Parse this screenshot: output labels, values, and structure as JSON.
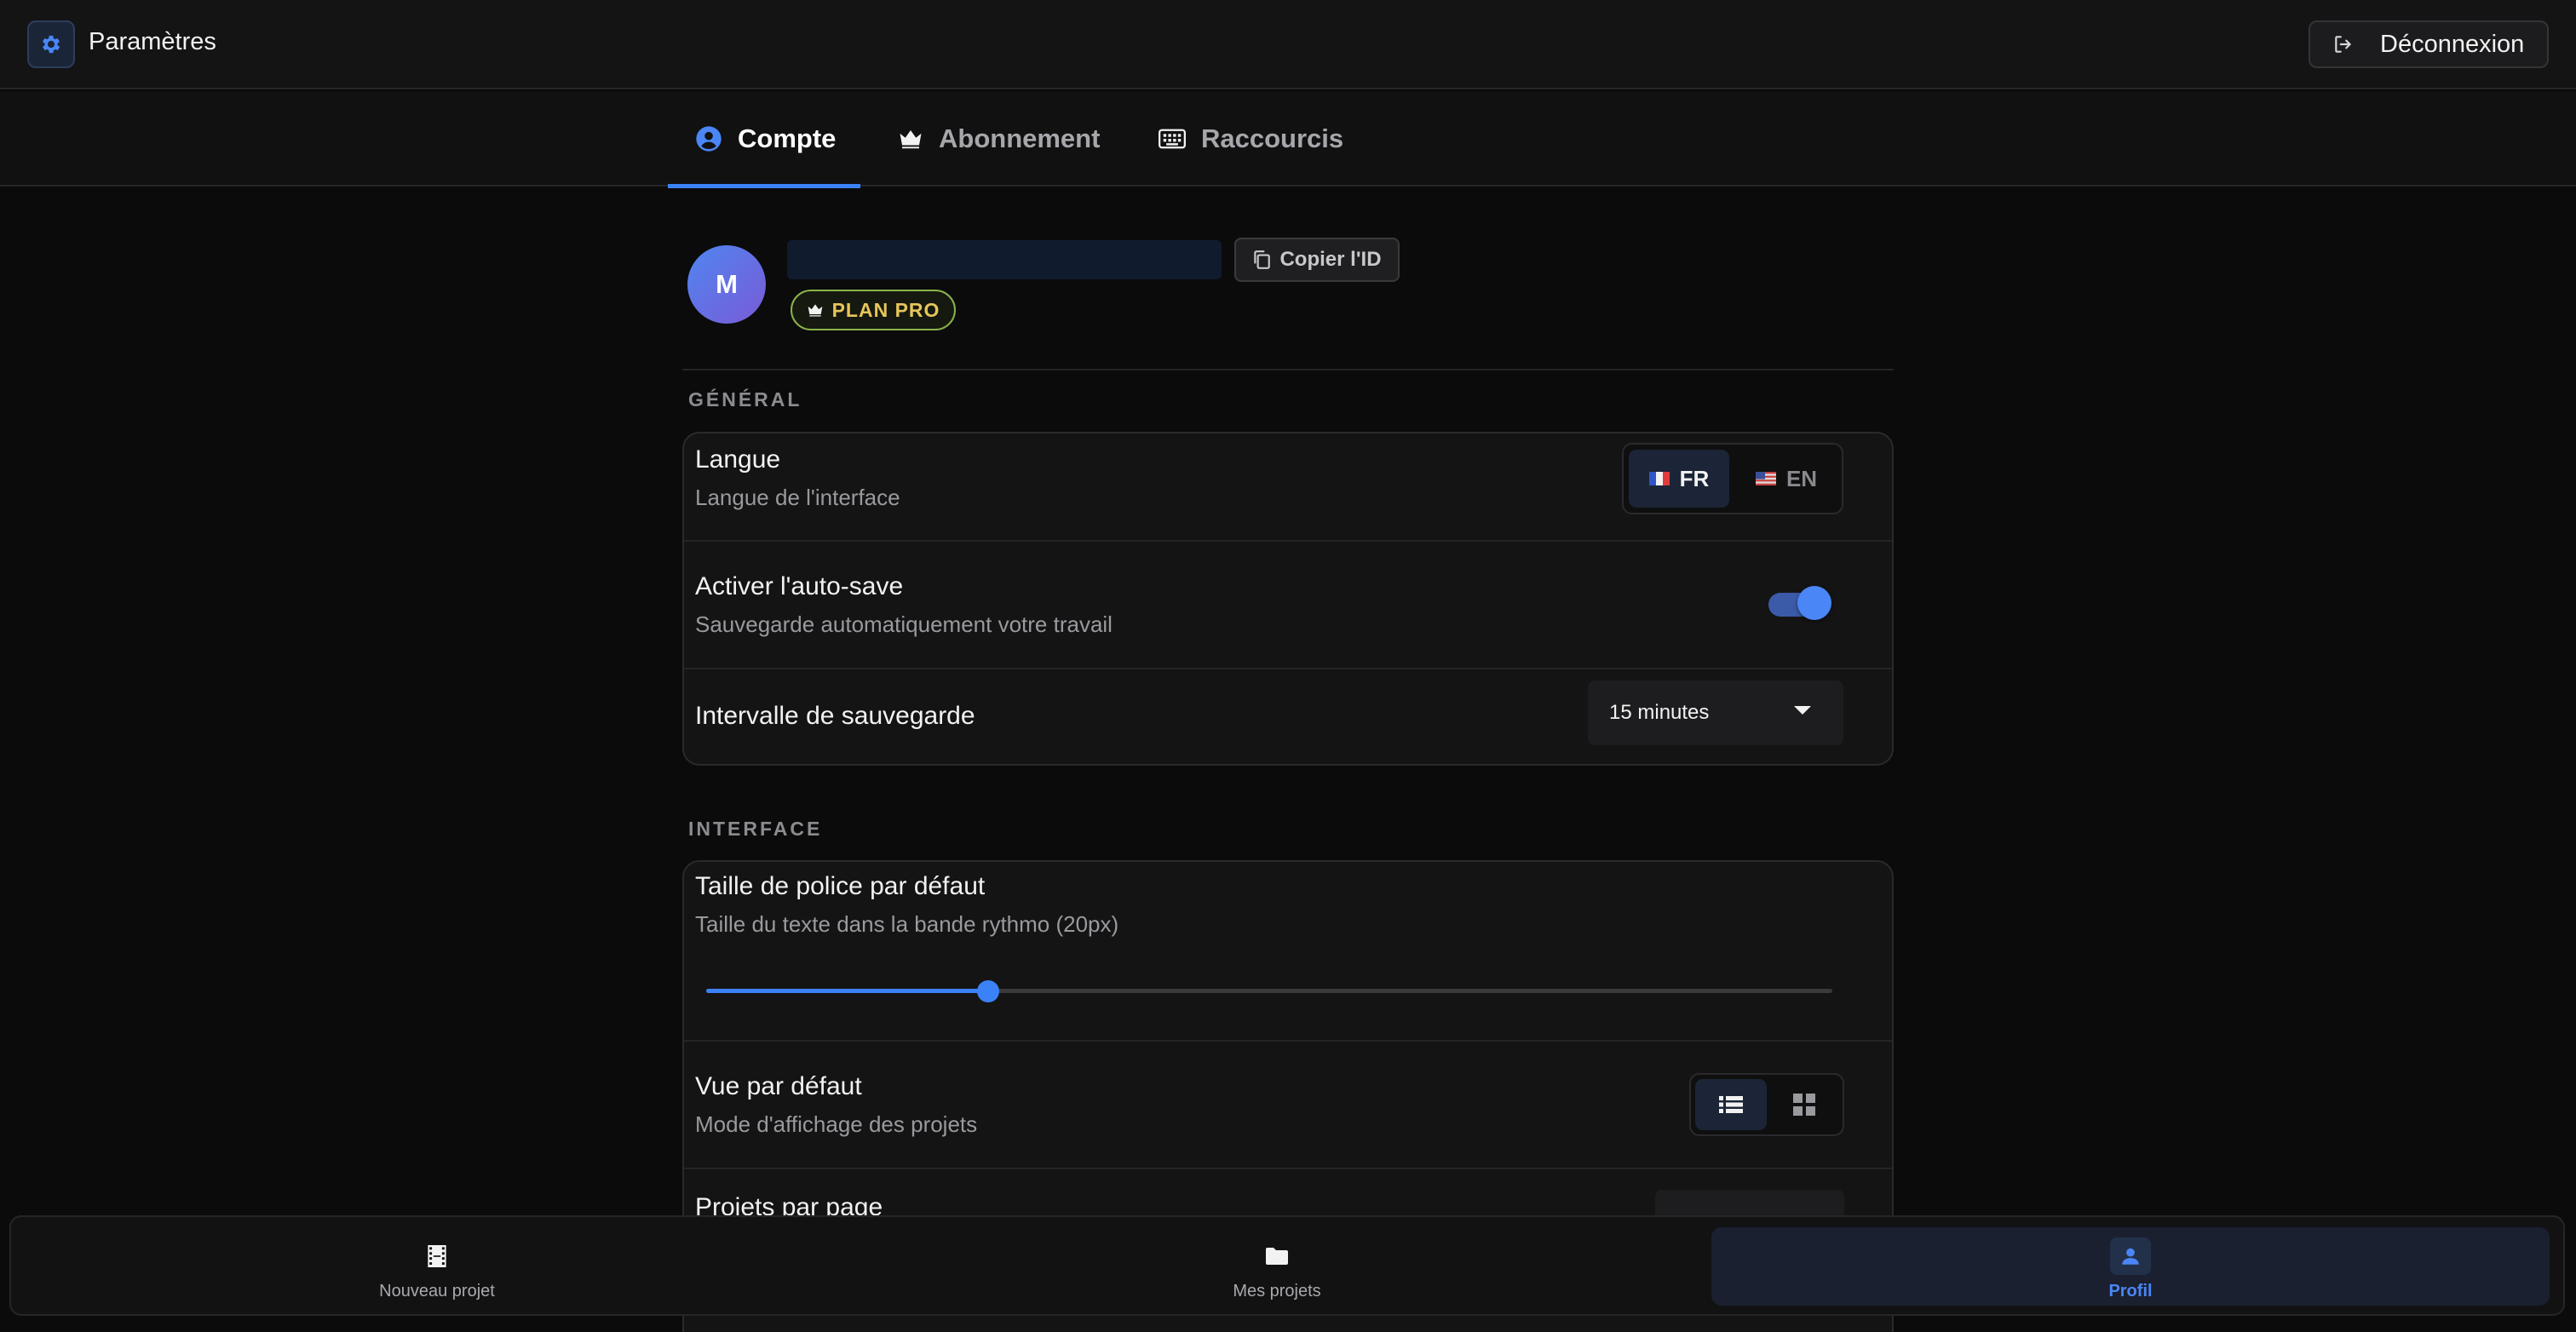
{
  "header": {
    "title": "Paramètres",
    "app_icon": "gear-icon",
    "logout_label": "Déconnexion",
    "logout_icon": "logout-icon"
  },
  "tabs": [
    {
      "label": "Compte",
      "icon": "user-circle-icon",
      "active": true
    },
    {
      "label": "Abonnement",
      "icon": "crown-icon",
      "active": false
    },
    {
      "label": "Raccourcis",
      "icon": "keyboard-icon",
      "active": false
    }
  ],
  "profile": {
    "avatar_initial": "M",
    "copy_id_label": "Copier l'ID",
    "plan_label": "PLAN PRO"
  },
  "general": {
    "title": "GÉNÉRAL",
    "language": {
      "title": "Langue",
      "description": "Langue de l'interface",
      "options": [
        {
          "code": "FR",
          "flag": "flag-fr-icon",
          "active": true
        },
        {
          "code": "EN",
          "flag": "flag-us-icon",
          "active": false
        }
      ]
    },
    "autosave": {
      "title": "Activer l'auto-save",
      "description": "Sauvegarde automatiquement votre travail",
      "enabled": true
    },
    "interval": {
      "title": "Intervalle de sauvegarde",
      "value": "15 minutes"
    }
  },
  "interface": {
    "title": "INTERFACE",
    "font_size": {
      "title": "Taille de police par défaut",
      "description": "Taille du texte dans la bande rythmo (20px)",
      "level": 0.25
    },
    "default_view": {
      "title": "Vue par défaut",
      "description": "Mode d'affichage des projets",
      "options": [
        {
          "icon": "list-icon",
          "active": true
        },
        {
          "icon": "grid-icon",
          "active": false
        }
      ]
    },
    "projects_per_page": {
      "title": "Projets par page"
    }
  },
  "bottom_nav": [
    {
      "label": "Nouveau projet",
      "icon": "film-icon",
      "active": false
    },
    {
      "label": "Mes projets",
      "icon": "folder-icon",
      "active": false
    },
    {
      "label": "Profil",
      "icon": "user-icon",
      "active": true
    }
  ],
  "colors": {
    "accent": "#3b82f6",
    "background": "#0b0b0c",
    "card": "#141415",
    "plan_badge": "#e6c65a"
  }
}
